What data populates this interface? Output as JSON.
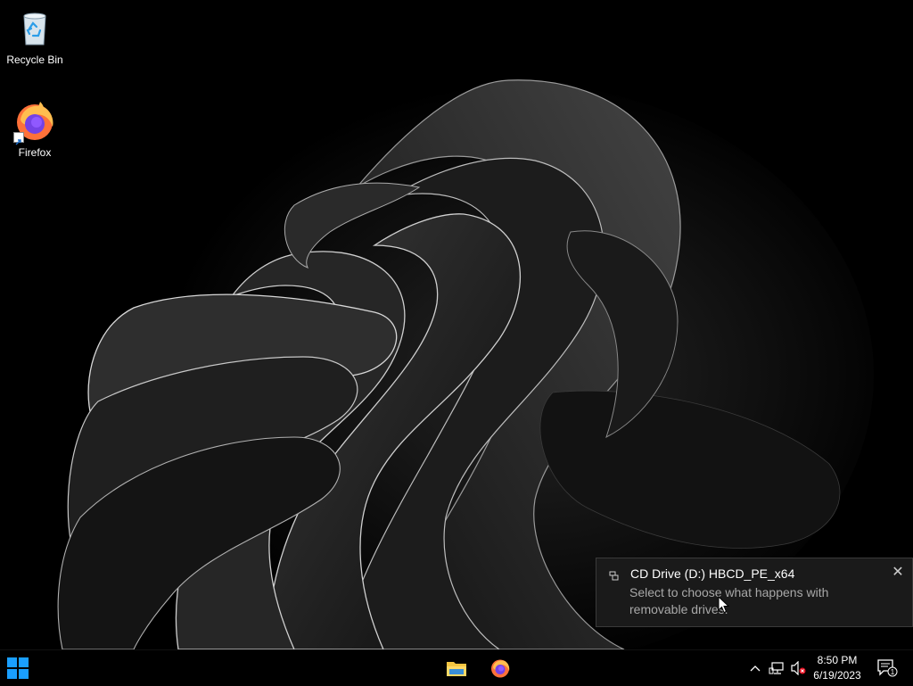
{
  "desktop": {
    "icons": [
      {
        "label": "Recycle Bin",
        "icon": "recycle-bin-icon"
      },
      {
        "label": "Firefox",
        "icon": "firefox-icon",
        "shortcut": true
      }
    ]
  },
  "toast": {
    "icon": "drive-icon",
    "title": "CD Drive (D:) HBCD_PE_x64",
    "body": "Select to choose what happens with removable drives.",
    "close": "✕"
  },
  "taskbar": {
    "start_icon": "windows-logo-icon",
    "pinned": [
      {
        "name": "file-explorer",
        "icon": "folder-icon"
      },
      {
        "name": "firefox",
        "icon": "firefox-icon"
      }
    ],
    "tray": {
      "chevron": "^",
      "network_icon": "network-icon",
      "volume_icon": "volume-muted-icon",
      "time": "8:50 PM",
      "date": "6/19/2023",
      "notification_count": "1"
    }
  },
  "colors": {
    "accent": "#0a74da",
    "toast_bg": "#1a1a1a",
    "toast_body": "#a8a8a8"
  }
}
